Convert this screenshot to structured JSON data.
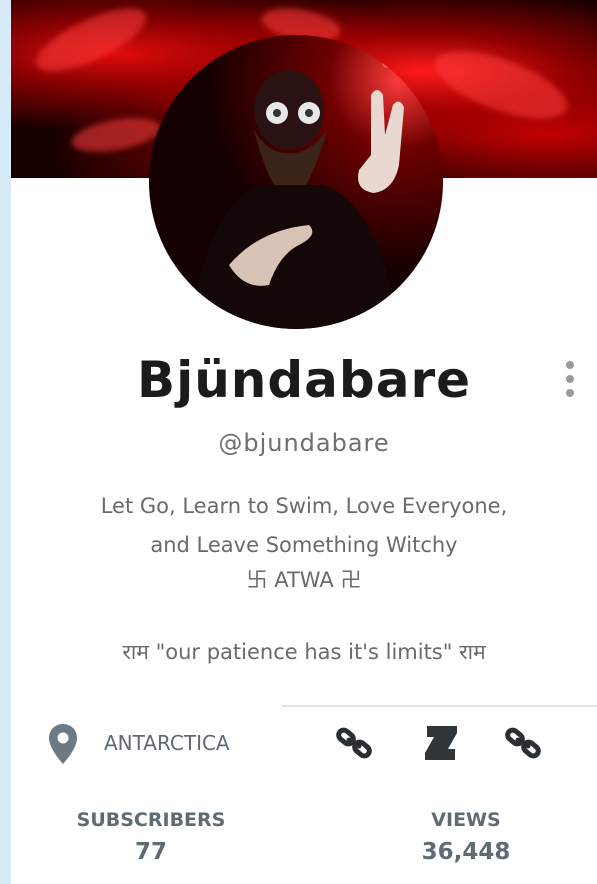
{
  "profile": {
    "name": "Bjündabare",
    "handle": "@bjundabare",
    "bio_line_1": "Let Go, Learn to Swim, Love Everyone,",
    "bio_line_2": "and Leave Something Witchy",
    "bio_line_3": "卐 ATWA 卍",
    "bio_line_4": "राम \"our patience has it's limits\" राम",
    "location": "ANTARCTICA"
  },
  "stats": {
    "subscribers_label": "SUBSCRIBERS",
    "subscribers_value": "77",
    "views_label": "VIEWS",
    "views_value": "36,448"
  },
  "icons": {
    "location": "map-pin-icon",
    "link_1": "chain-link-icon",
    "deviantart": "deviantart-icon",
    "link_2": "chain-link-icon",
    "more": "vertical-dots-icon"
  },
  "colors": {
    "banner_red": "#d40000",
    "text_dark": "#1b1b1b",
    "text_muted": "#6a6a6a",
    "stat_text": "#5f6b73",
    "page_bg": "#d7eaf8"
  }
}
